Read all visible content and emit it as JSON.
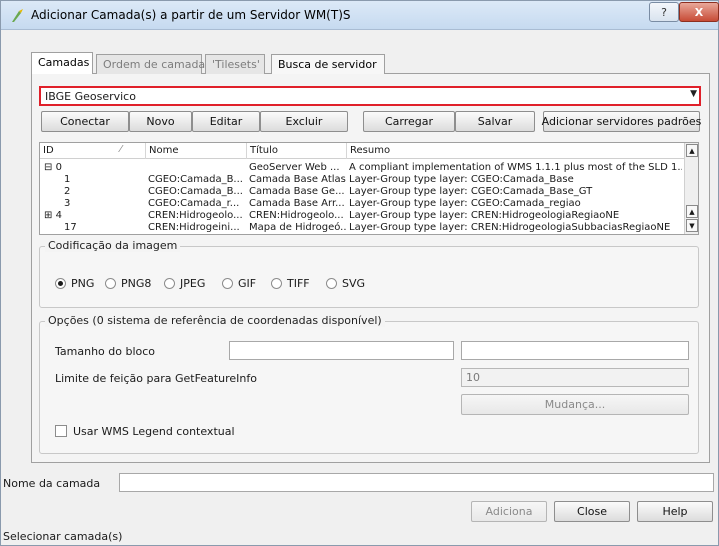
{
  "window": {
    "title": "Adicionar Camada(s) a partir de um Servidor WM(T)S",
    "help_glyph": "?",
    "close_glyph": "X"
  },
  "tabs": [
    {
      "label": "Camadas"
    },
    {
      "label": "Ordem de camada"
    },
    {
      "label": "'Tilesets'"
    },
    {
      "label": "Busca de servidor"
    }
  ],
  "server": {
    "selected": "IBGE Geoservico",
    "arrow": "▼"
  },
  "server_buttons": {
    "connect": "Conectar",
    "new": "Novo",
    "edit": "Editar",
    "delete": "Excluir",
    "load": "Carregar",
    "save": "Salvar",
    "add_defaults": "Adicionar servidores padrões"
  },
  "layer_tree": {
    "columns": [
      "ID",
      "Nome",
      "Título",
      "Resumo"
    ],
    "rows": [
      {
        "prefix": "⊟ ",
        "id": "0",
        "name": "",
        "title": "GeoServer Web ...",
        "summary": "A compliant implementation of WMS 1.1.1 plus most of the SLD 1...."
      },
      {
        "prefix": "",
        "id": "1",
        "name": "CGEO:Camada_B...",
        "title": "Camada Base Atlas",
        "summary": "Layer-Group type layer: CGEO:Camada_Base"
      },
      {
        "prefix": "",
        "id": "2",
        "name": "CGEO:Camada_B...",
        "title": "Camada Base Ge...",
        "summary": "Layer-Group type layer: CGEO:Camada_Base_GT"
      },
      {
        "prefix": "",
        "id": "3",
        "name": "CGEO:Camada_r...",
        "title": "Camada Base Arr...",
        "summary": "Layer-Group type layer: CGEO:Camada_regiao"
      },
      {
        "prefix": "⊞ ",
        "id": "4",
        "name": "CREN:Hidrogeolo...",
        "title": "CREN:Hidrogeolo...",
        "summary": "Layer-Group type layer: CREN:HidrogeologiaRegiaoNE"
      },
      {
        "prefix": "",
        "id": "17",
        "name": "CREN:Hidrogeini...",
        "title": "Mapa de Hidrogeó...",
        "summary": "Layer-Group type layer: CREN:HidrogeologiaSubbaciasRegiaoNE"
      }
    ]
  },
  "image_encoding": {
    "legend": "Codificação da imagem",
    "options": [
      "PNG",
      "PNG8",
      "JPEG",
      "GIF",
      "TIFF",
      "SVG"
    ],
    "selected": "PNG"
  },
  "options_group": {
    "legend": "Opções (0 sistema de referência de coordenadas disponível)",
    "tile_size_label": "Tamanho do bloco",
    "tile_size_value": "",
    "tile_size_value2": "",
    "feature_limit_label": "Limite de feição para GetFeatureInfo",
    "feature_limit_value": "10",
    "change_button": "Mudança...",
    "contextual_legend_label": "Usar WMS Legend contextual"
  },
  "layer_name": {
    "label": "Nome da camada",
    "value": ""
  },
  "footer_buttons": {
    "add": "Adiciona",
    "close": "Close",
    "help": "Help"
  },
  "status": {
    "text": "Selecionar camada(s)"
  },
  "colors": {
    "highlight_border": "#e0202a",
    "title_bar": "#c6daf0"
  }
}
